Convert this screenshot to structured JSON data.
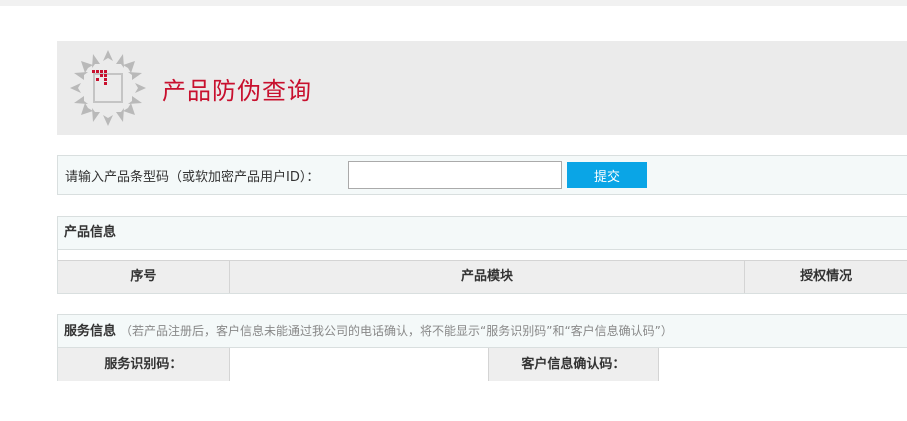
{
  "header": {
    "title": "产品防伪查询",
    "logo_icon": "arrow-star-logo",
    "logo_accent_color": "#c8102e"
  },
  "search": {
    "label": "请输入产品条型码（或软加密产品用户ID）：",
    "value": "",
    "placeholder": "",
    "submit_label": "提交",
    "submit_color": "#0aa5e6"
  },
  "product_info": {
    "title": "产品信息",
    "columns": [
      "序号",
      "产品模块",
      "授权情况"
    ]
  },
  "service_info": {
    "title": "服务信息",
    "note": "（若产品注册后，客户信息未能通过我公司的电话确认，将不能显示“服务识别码”和“客户信息确认码”）",
    "service_code_label": "服务识别码：",
    "service_code_value": "",
    "customer_code_label": "客户信息确认码：",
    "customer_code_value": ""
  }
}
